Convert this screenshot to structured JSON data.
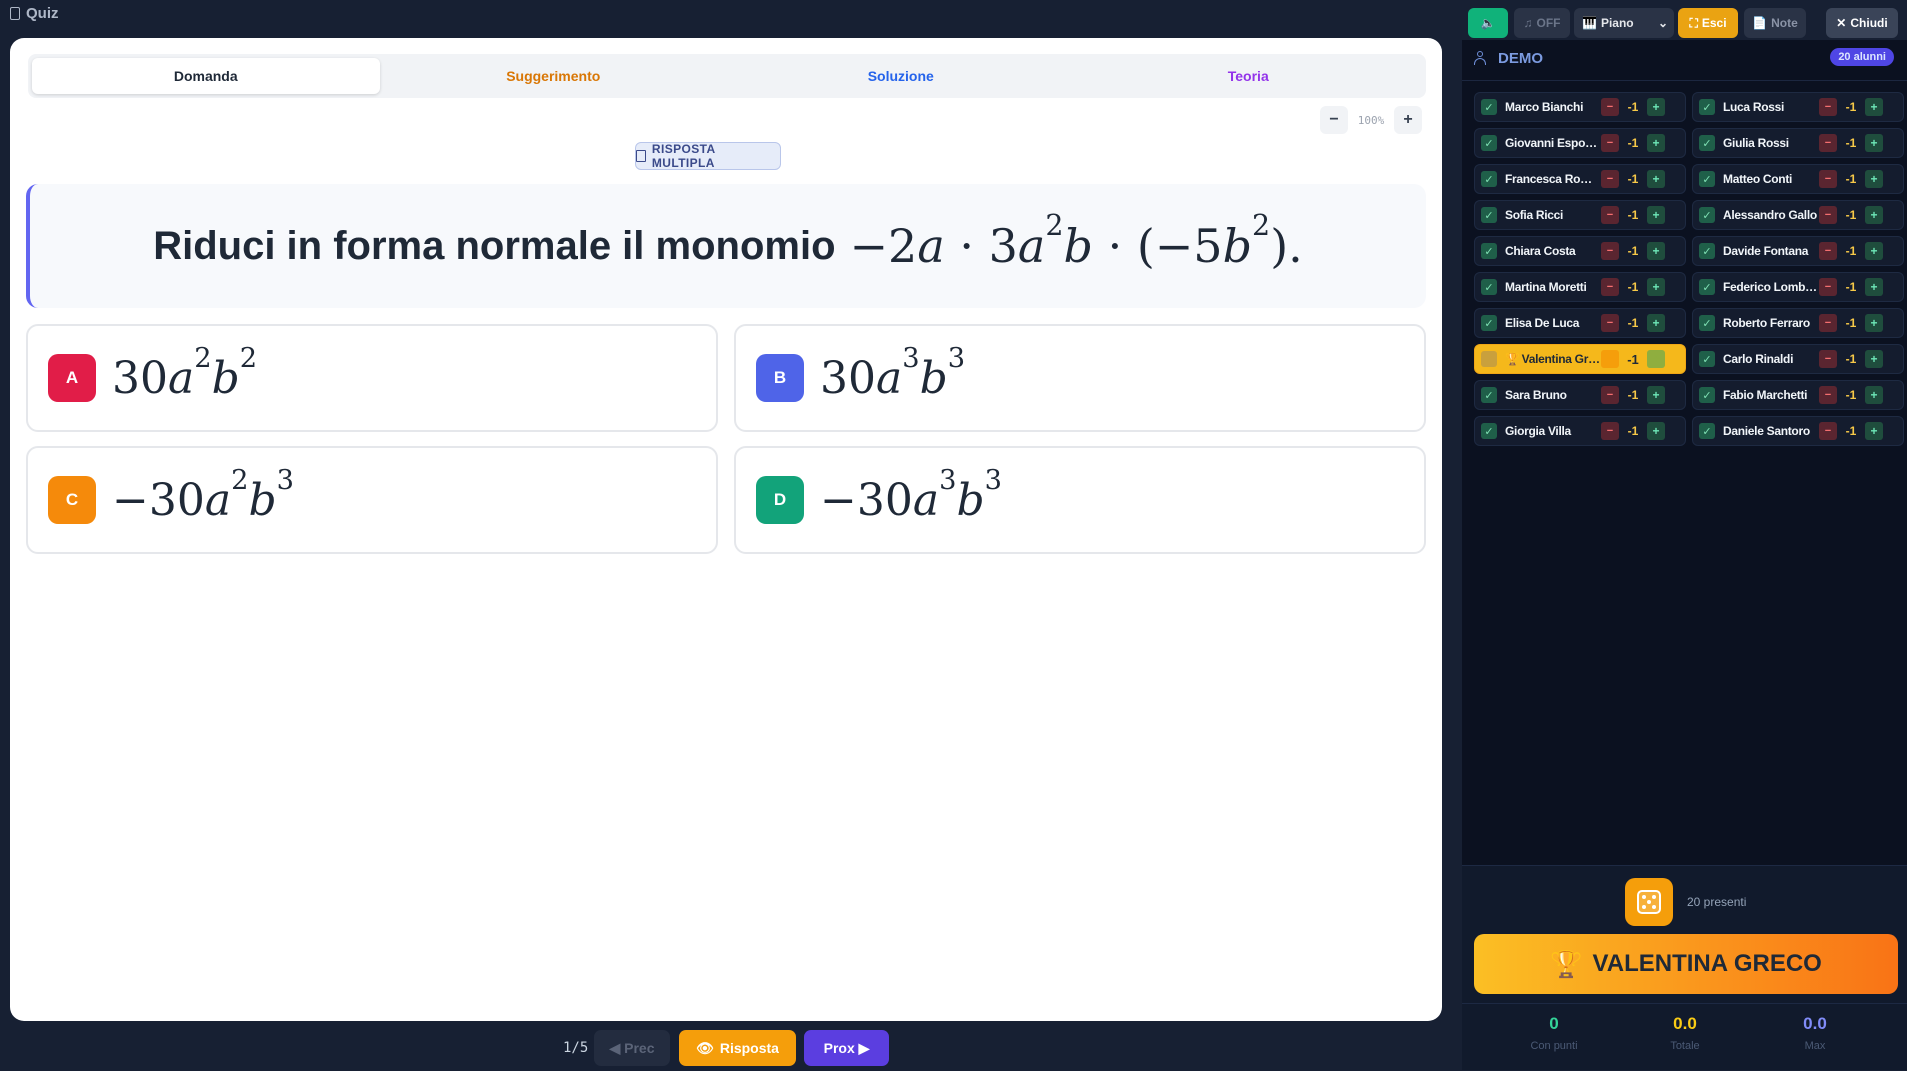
{
  "app": {
    "title": "Quiz"
  },
  "tabs": [
    {
      "label": "Domanda",
      "color": "#1f2937"
    },
    {
      "label": "Suggerimento",
      "color": "#d97706"
    },
    {
      "label": "Soluzione",
      "color": "#2563eb"
    },
    {
      "label": "Teoria",
      "color": "#9333ea"
    }
  ],
  "zoom": {
    "minus": "−",
    "value": "100%",
    "plus": "+"
  },
  "question": {
    "type_label": "RISPOSTA MULTIPLA",
    "text": "Riduci in forma normale il monomio"
  },
  "options": [
    {
      "letter": "A",
      "color": "#e11d48"
    },
    {
      "letter": "B",
      "color": "#4f64e8"
    },
    {
      "letter": "C",
      "color": "#f58a0b"
    },
    {
      "letter": "D",
      "color": "#12a37a"
    }
  ],
  "nav": {
    "counter": "1/5",
    "prev": "◀ Prec",
    "answer": "Risposta",
    "next": "Prox ▶"
  },
  "toolbar": {
    "sound_off": "OFF",
    "instrument": "Piano",
    "exit": "Esci",
    "note": "Note",
    "close": "Chiudi"
  },
  "class": {
    "name": "DEMO",
    "count": "20 alunni"
  },
  "students_left": [
    {
      "name": "Marco Bianchi",
      "score": "-1"
    },
    {
      "name": "Giovanni Esposito",
      "score": "-1"
    },
    {
      "name": "Francesca Romano",
      "score": "-1"
    },
    {
      "name": "Sofia Ricci",
      "score": "-1"
    },
    {
      "name": "Chiara Costa",
      "score": "-1"
    },
    {
      "name": "Martina Moretti",
      "score": "-1"
    },
    {
      "name": "Elisa De Luca",
      "score": "-1"
    },
    {
      "name": "Valentina Greco",
      "score": "-1",
      "highlight": true
    },
    {
      "name": "Sara Bruno",
      "score": "-1"
    },
    {
      "name": "Giorgia Villa",
      "score": "-1"
    }
  ],
  "students_right": [
    {
      "name": "Luca Rossi",
      "score": "-1"
    },
    {
      "name": "Giulia Rossi",
      "score": "-1"
    },
    {
      "name": "Matteo Conti",
      "score": "-1"
    },
    {
      "name": "Alessandro Gallo",
      "score": "-1"
    },
    {
      "name": "Davide Fontana",
      "score": "-1"
    },
    {
      "name": "Federico Lombardi",
      "score": "-1"
    },
    {
      "name": "Roberto Ferraro",
      "score": "-1"
    },
    {
      "name": "Carlo Rinaldi",
      "score": "-1"
    },
    {
      "name": "Fabio Marchetti",
      "score": "-1"
    },
    {
      "name": "Daniele Santoro",
      "score": "-1"
    }
  ],
  "picker": {
    "present": "20 presenti",
    "winner": "VALENTINA GRECO"
  },
  "stats": [
    {
      "value": "0",
      "label": "Con punti",
      "color": "#34d399"
    },
    {
      "value": "0.0",
      "label": "Totale",
      "color": "#facc15"
    },
    {
      "value": "0.0",
      "label": "Max",
      "color": "#818cf8"
    }
  ]
}
